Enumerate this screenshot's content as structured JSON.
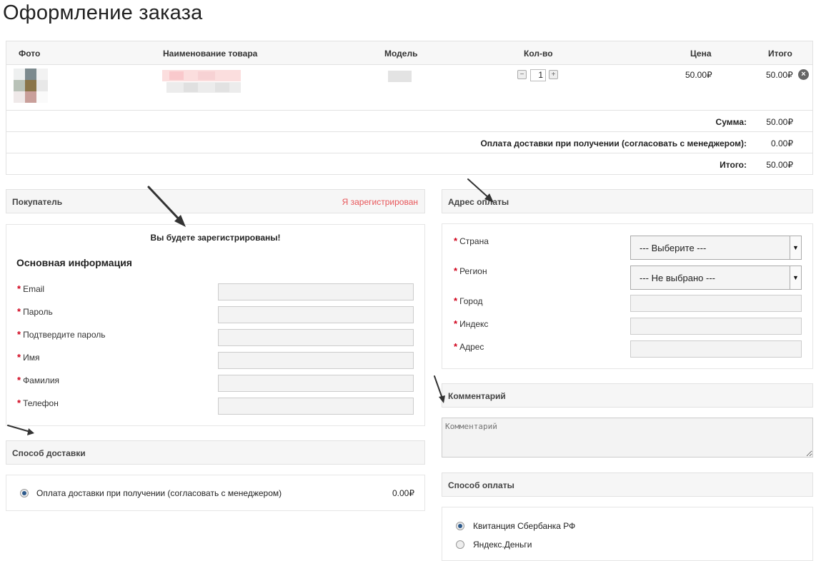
{
  "page": {
    "title": "Оформление заказа"
  },
  "cart": {
    "headers": {
      "photo": "Фото",
      "name": "Наименование товара",
      "model": "Модель",
      "qty": "Кол-во",
      "price": "Цена",
      "total": "Итого"
    },
    "item": {
      "qty": "1",
      "price": "50.00₽",
      "total": "50.00₽"
    },
    "totals": [
      {
        "label": "Сумма:",
        "value": "50.00₽"
      },
      {
        "label": "Оплата доставки при получении (согласовать с менеджером):",
        "value": "0.00₽"
      },
      {
        "label": "Итого:",
        "value": "50.00₽"
      }
    ]
  },
  "buyer": {
    "title": "Покупатель",
    "login_link": "Я зарегистрирован",
    "notice": "Вы будете зарегистрированы!",
    "section_title": "Основная информация",
    "fields": [
      {
        "label": "Email"
      },
      {
        "label": "Пароль"
      },
      {
        "label": "Подтвердите пароль"
      },
      {
        "label": "Имя"
      },
      {
        "label": "Фамилия"
      },
      {
        "label": "Телефон"
      }
    ]
  },
  "shipping": {
    "title": "Способ доставки",
    "option": {
      "label": "Оплата доставки при получении (согласовать с менеджером)",
      "price": "0.00₽"
    }
  },
  "billing": {
    "title": "Адрес оплаты",
    "country": {
      "label": "Страна",
      "value": "--- Выберите ---"
    },
    "region": {
      "label": "Регион",
      "value": "--- Не выбрано ---"
    },
    "city": {
      "label": "Город"
    },
    "zip": {
      "label": "Индекс"
    },
    "address": {
      "label": "Адрес"
    }
  },
  "comment": {
    "title": "Комментарий",
    "placeholder": "Комментарий"
  },
  "payment": {
    "title": "Способ оплаты",
    "options": [
      {
        "label": "Квитанция Сбербанка РФ",
        "selected": true
      },
      {
        "label": "Яндекс.Деньги",
        "selected": false
      }
    ]
  },
  "colors": {
    "link": "#e8565a",
    "required": "#d0021b",
    "header_bg": "#f6f6f6",
    "border": "#e2e2e2"
  }
}
